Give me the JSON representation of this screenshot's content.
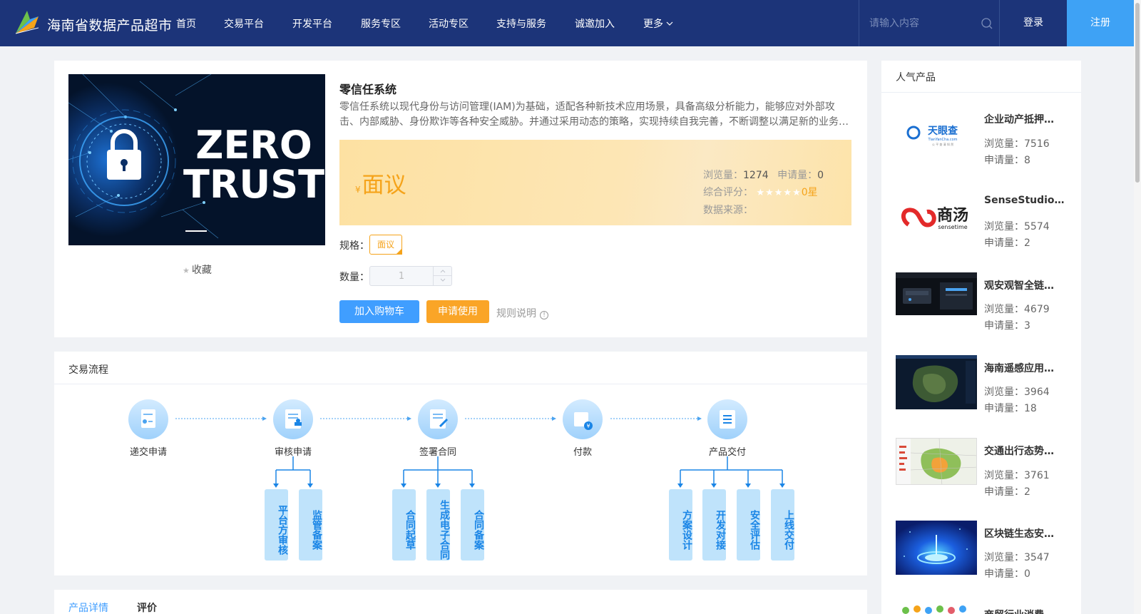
{
  "brand": {
    "name": "海南省数据产品超市"
  },
  "nav": {
    "items": [
      "首页",
      "交易平台",
      "开发平台",
      "服务专区",
      "活动专区",
      "支持与服务",
      "诚邀加入",
      "更多"
    ],
    "search_placeholder": "请输入内容",
    "login": "登录",
    "register": "注册"
  },
  "product": {
    "image_text": [
      "ZERO",
      "TRUST"
    ],
    "favorite": "收藏",
    "title": "零信任系统",
    "description": "零信任系统以现代身份与访问管理(IAM)为基础，适配各种新技术应用场景，具备高级分析能力，能够应对外部攻击、内部威胁、身份欺诈等各种安全威胁。并通过采用动态的策略，实现持续自我完善，不断调整以满足新的业务…",
    "currency": "¥",
    "price": "面议",
    "views_label": "浏览量：",
    "views": "1274",
    "applications_label": "申请量：",
    "applications": "0",
    "rating_label": "综合评分：",
    "rating_stars": 0,
    "rating_text": "0星",
    "source_label": "数据来源：",
    "spec_label": "规格：",
    "spec_value": "面议",
    "qty_label": "数量：",
    "qty_value": "1",
    "add_to_cart": "加入购物车",
    "apply": "申请使用",
    "rules": "规则说明"
  },
  "process": {
    "title": "交易流程",
    "steps": [
      "递交申请",
      "审核申请",
      "签署合同",
      "付款",
      "产品交付"
    ],
    "substeps": {
      "review": [
        "平台方审核",
        "监管备案"
      ],
      "contract": [
        "合同起草",
        "生成电子合同",
        "合同备案"
      ],
      "delivery": [
        "方案设计",
        "开发对接",
        "安全评估",
        "上线交付"
      ]
    }
  },
  "tabs": [
    "产品详情",
    "评价"
  ],
  "popular": {
    "title": "人气产品",
    "views_label": "浏览量：",
    "applications_label": "申请量：",
    "items": [
      {
        "name": "企业动产抵押…",
        "views": "7516",
        "applications": "8",
        "logo_text": "天眼查",
        "logo_sub": "TianYanCha.com",
        "logo_caption": "公 平 查 清 知 然"
      },
      {
        "name": "SenseStudio…",
        "views": "5574",
        "applications": "2",
        "logo_text": "商汤",
        "logo_sub": "sensetime"
      },
      {
        "name": "观安观智全链…",
        "views": "4679",
        "applications": "3"
      },
      {
        "name": "海南遥感应用…",
        "views": "3964",
        "applications": "18"
      },
      {
        "name": "交通出行态势…",
        "views": "3761",
        "applications": "2"
      },
      {
        "name": "区块链生态安…",
        "views": "3547",
        "applications": "0"
      },
      {
        "name": "商贸行业消费…",
        "views": "",
        "applications": ""
      }
    ]
  },
  "colors": {
    "nav_bg": "#1c3479",
    "primary": "#409eff",
    "accent": "#f5a31a",
    "register": "#3ea2f5"
  }
}
